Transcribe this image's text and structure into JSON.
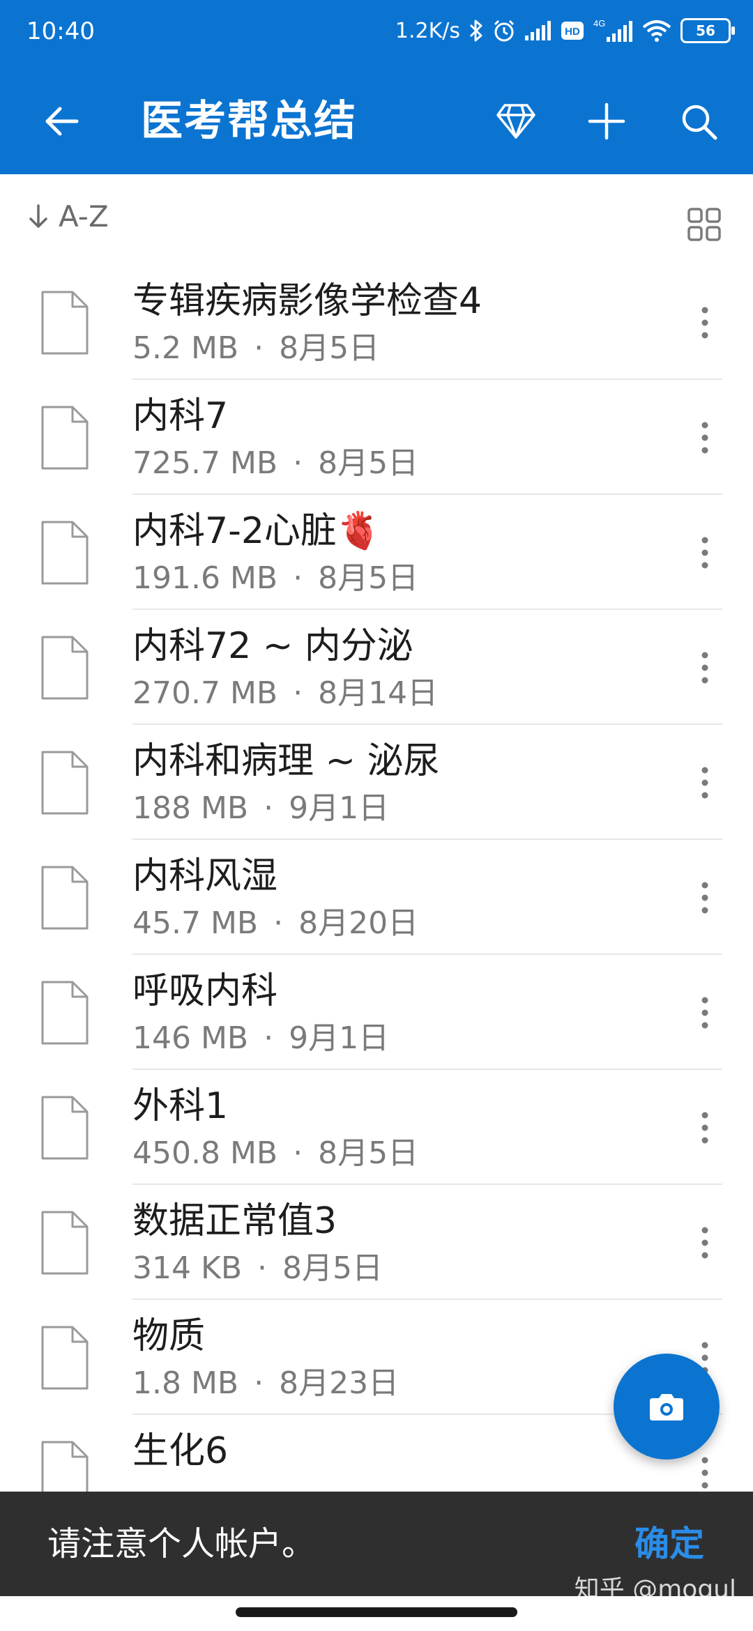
{
  "status_bar": {
    "time": "10:40",
    "network_speed": "1.2K/s",
    "network_type": "4G",
    "hd_badge": "HD",
    "battery_level": "56",
    "icons": [
      "bluetooth-icon",
      "alarm-icon",
      "signal-icon",
      "hd-icon",
      "signal-4g-icon",
      "wifi-icon",
      "battery-icon"
    ]
  },
  "app_bar": {
    "title": "医考帮总结",
    "actions": [
      "back-arrow-icon",
      "diamond-icon",
      "plus-icon",
      "search-icon"
    ]
  },
  "sort": {
    "label": "A-Z",
    "icon": "arrow-down-icon",
    "view_toggle_icon": "grid-icon"
  },
  "files": [
    {
      "name": "专辑疾病影像学检查4",
      "size": "5.2 MB",
      "date": "8月5日"
    },
    {
      "name": "内科7",
      "size": "725.7 MB",
      "date": "8月5日"
    },
    {
      "name": "内科7-2心脏🫀",
      "size": "191.6 MB",
      "date": "8月5日"
    },
    {
      "name": "内科72 ~ 内分泌",
      "size": "270.7 MB",
      "date": "8月14日"
    },
    {
      "name": "内科和病理 ~ 泌尿",
      "size": "188 MB",
      "date": "9月1日"
    },
    {
      "name": "内科风湿",
      "size": "45.7 MB",
      "date": "8月20日"
    },
    {
      "name": "呼吸内科",
      "size": "146 MB",
      "date": "9月1日"
    },
    {
      "name": "外科1",
      "size": "450.8 MB",
      "date": "8月5日"
    },
    {
      "name": "数据正常值3",
      "size": "314 KB",
      "date": "8月5日"
    },
    {
      "name": "物质",
      "size": "1.8 MB",
      "date": "8月23日"
    },
    {
      "name": "生化6",
      "size": "",
      "date": ""
    }
  ],
  "fab": {
    "icon": "camera-icon"
  },
  "snackbar": {
    "message": "请注意个人帐户。",
    "action": "确定"
  },
  "watermark": "知乎 @mogul",
  "colors": {
    "primary": "#0b74d1",
    "snackbar_bg": "#2f2f2f",
    "snackbar_action": "#2a8de8"
  }
}
